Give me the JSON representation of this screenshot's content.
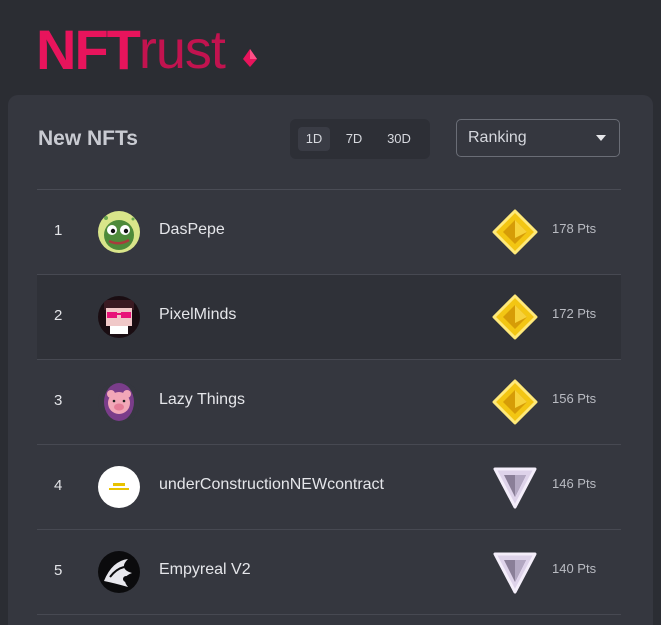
{
  "header": {
    "logo_primary": "NFT",
    "logo_secondary": "rust",
    "brand_color": "#e8145c"
  },
  "panel": {
    "title": "New NFTs",
    "ranges": [
      "1D",
      "7D",
      "30D"
    ],
    "active_range": "1D",
    "sort_select": {
      "value": "Ranking",
      "icon": "chevron-down-icon"
    }
  },
  "collections": [
    {
      "rank": "1",
      "name": "DasPepe",
      "points": "178 Pts",
      "badge": "gold-diamond-badge"
    },
    {
      "rank": "2",
      "name": "PixelMinds",
      "points": "172 Pts",
      "badge": "gold-diamond-badge"
    },
    {
      "rank": "3",
      "name": "Lazy Things",
      "points": "156 Pts",
      "badge": "gold-diamond-badge"
    },
    {
      "rank": "4",
      "name": "underConstructionNEWcontract",
      "points": "146 Pts",
      "badge": "silver-triangle-badge"
    },
    {
      "rank": "5",
      "name": "Empyreal V2",
      "points": "140 Pts",
      "badge": "silver-triangle-badge"
    }
  ]
}
